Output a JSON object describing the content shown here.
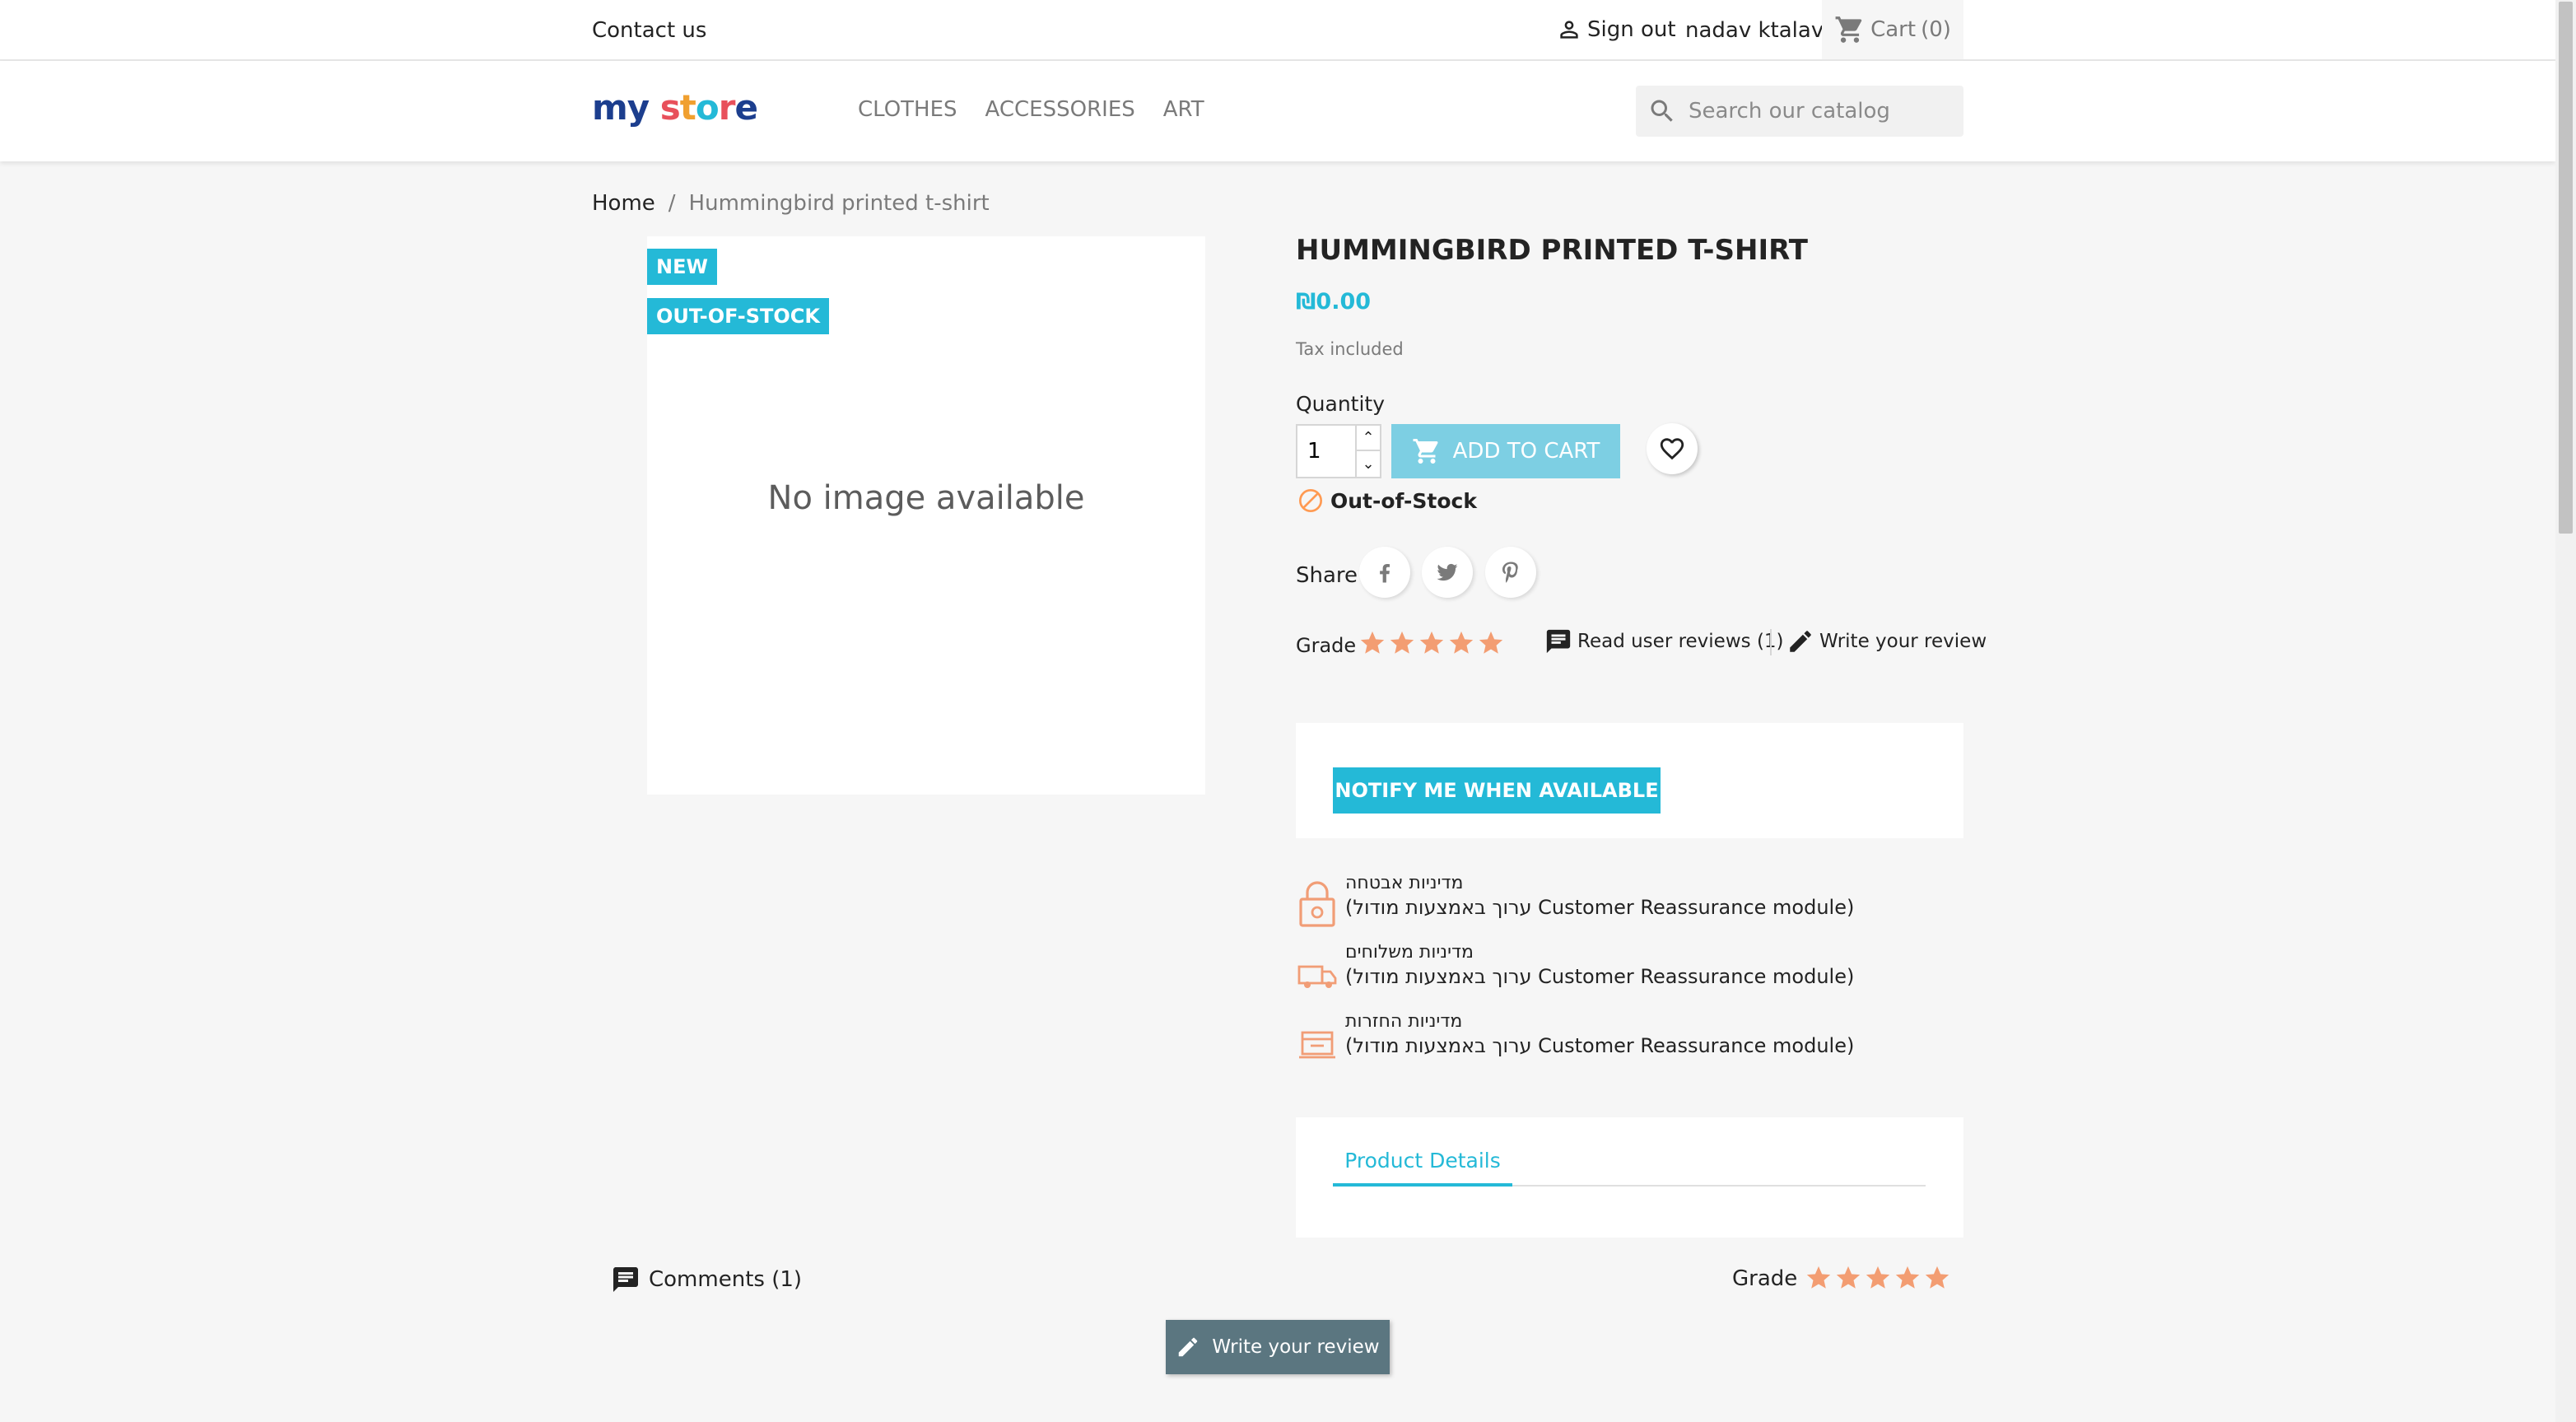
{
  "topnav": {
    "contact": "Contact us",
    "signout": "Sign out",
    "username": "nadav ktalav",
    "cart": "Cart",
    "cart_count": "(0)"
  },
  "header": {
    "logo_parts": [
      "my",
      " ",
      "s",
      "t",
      "o",
      "r",
      "e"
    ],
    "menu": [
      "Clothes",
      "Accessories",
      "Art"
    ],
    "search_placeholder": "Search our catalog"
  },
  "breadcrumb": {
    "home": "Home",
    "separator": "/",
    "current": "Hummingbird printed t-shirt"
  },
  "product": {
    "badges": [
      "New",
      "Out-of-Stock"
    ],
    "no_image": "No image available",
    "title": "Hummingbird printed t-shirt",
    "price": "₪0.00",
    "tax": "Tax included",
    "quantity_label": "Quantity",
    "quantity_value": "1",
    "add_to_cart": "Add to cart",
    "availability": "Out-of-Stock",
    "share_label": "Share",
    "grade_label": "Grade",
    "rating": 5,
    "read_reviews": "Read user reviews (1)",
    "write_review": "Write your review",
    "notify": "Notify me when available"
  },
  "reassurance": [
    {
      "title": "מדיניות אבטחה",
      "text": "(ערוך באמצעות מודול Customer Reassurance module)",
      "icon": "lock-icon"
    },
    {
      "title": "מדיניות משלוחים",
      "text": "(ערוך באמצעות מודול Customer Reassurance module)",
      "icon": "truck-icon"
    },
    {
      "title": "מדיניות החזרות",
      "text": "(ערוך באמצעות מודול Customer Reassurance module)",
      "icon": "return-box-icon"
    }
  ],
  "tabs": [
    "Product Details"
  ],
  "comments": {
    "label": "Comments (1)",
    "grade_label": "Grade",
    "rating": 5,
    "write_button": "Write your review"
  },
  "colors": {
    "accent": "#24b9d7",
    "star": "#f39d72",
    "reassurance_icon": "#f19d76",
    "disabled_button": "#7dcfe3",
    "write_button": "#5b7680"
  }
}
